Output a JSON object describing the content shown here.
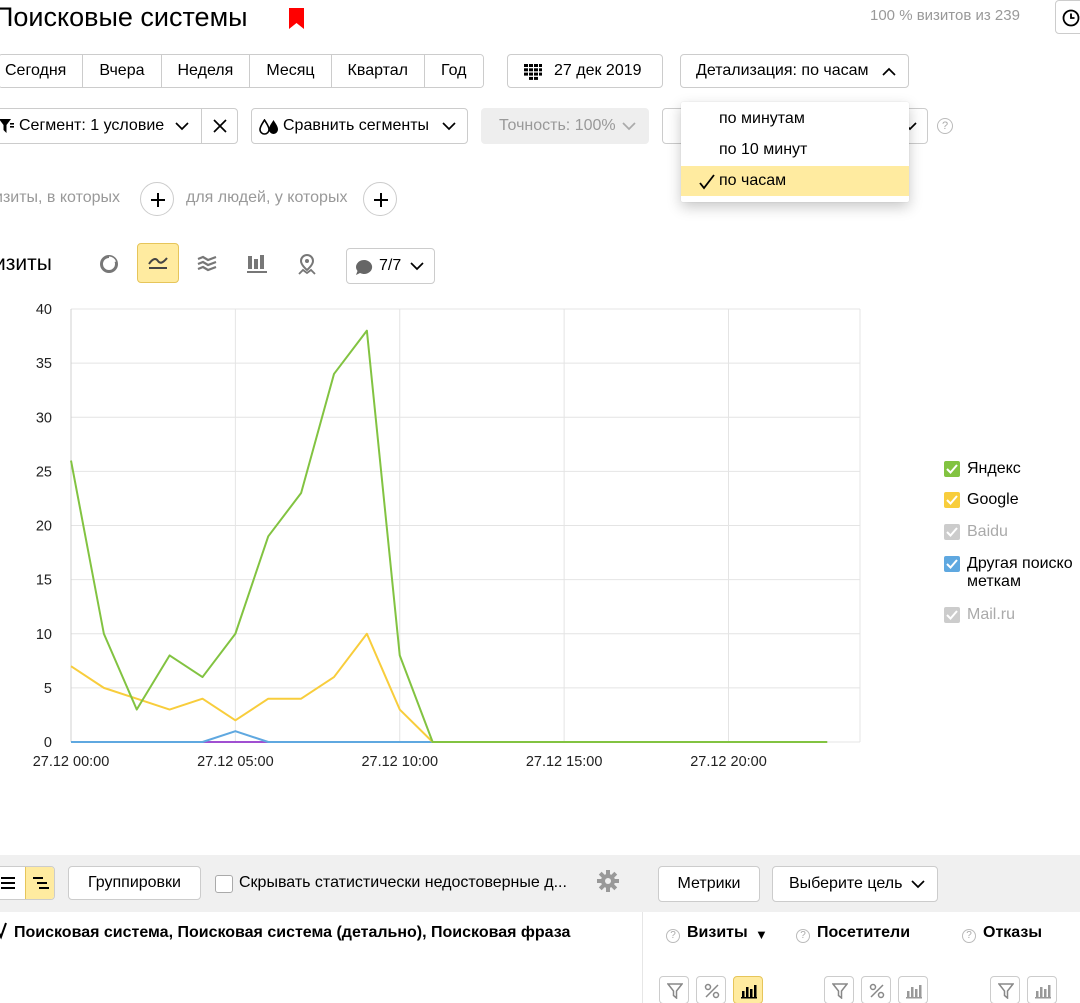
{
  "header": {
    "title": "Поисковые системы",
    "visits_info": "100 % визитов из 239"
  },
  "periods": [
    "Сегодня",
    "Вчера",
    "Неделя",
    "Месяц",
    "Квартал",
    "Год"
  ],
  "date_label": "27 дек 2019",
  "detail_label": "Детализация: по часам",
  "detail_options": [
    "по минутам",
    "по 10 минут",
    "по часам"
  ],
  "detail_selected": "по часам",
  "segment_label": "Сегмент: 1 условие",
  "compare_label": "Сравнить сегменты",
  "accuracy_label": "Точность: 100%",
  "conditions": {
    "visits_prefix": "изиты, в которых",
    "people_prefix": "для людей, у которых"
  },
  "chart_toolbar": {
    "label": "изиты",
    "series_count": "7/7"
  },
  "chart_data": {
    "type": "line",
    "x": [
      "27.12 00:00",
      "27.12 01:00",
      "27.12 02:00",
      "27.12 03:00",
      "27.12 04:00",
      "27.12 05:00",
      "27.12 06:00",
      "27.12 07:00",
      "27.12 08:00",
      "27.12 09:00",
      "27.12 10:00",
      "27.12 11:00",
      "27.12 12:00",
      "27.12 13:00",
      "27.12 14:00",
      "27.12 15:00",
      "27.12 16:00",
      "27.12 17:00",
      "27.12 18:00",
      "27.12 19:00",
      "27.12 20:00",
      "27.12 21:00",
      "27.12 22:00",
      "27.12 23:00"
    ],
    "x_tick_labels": [
      "27.12 00:00",
      "27.12 05:00",
      "27.12 10:00",
      "27.12 15:00",
      "27.12 20:00"
    ],
    "ylim": [
      0,
      40
    ],
    "y_ticks": [
      0,
      5,
      10,
      15,
      20,
      25,
      30,
      35,
      40
    ],
    "grid": true,
    "legend_position": "right",
    "series": [
      {
        "name": "Яндекс",
        "color": "#82c341",
        "checked": true,
        "values": [
          26,
          10,
          3,
          8,
          6,
          10,
          19,
          23,
          34,
          38,
          8,
          0,
          0,
          0,
          0,
          0,
          0,
          0,
          0,
          0,
          0,
          0,
          0,
          0
        ]
      },
      {
        "name": "Google",
        "color": "#f8cd3c",
        "checked": true,
        "values": [
          7,
          5,
          4,
          3,
          4,
          2,
          4,
          4,
          6,
          10,
          3,
          0,
          0,
          0,
          0,
          0,
          0,
          0,
          0,
          0,
          0,
          0,
          0,
          0
        ]
      },
      {
        "name": "Baidu",
        "color": "#cccccc",
        "checked": false,
        "values": [
          0,
          0,
          0,
          0,
          0,
          0,
          0,
          0,
          0,
          0,
          0,
          0,
          0,
          0,
          0,
          0,
          0,
          0,
          0,
          0,
          0,
          0,
          0,
          0
        ]
      },
      {
        "name": "Другая поисковая система по меткам",
        "color": "#5fa8e0",
        "checked": true,
        "values": [
          0,
          0,
          0,
          0,
          0,
          1,
          0,
          0,
          0,
          0,
          0,
          0,
          0,
          0,
          0,
          0,
          0,
          0,
          0,
          0,
          0,
          0,
          0,
          0
        ]
      },
      {
        "name": "Mail.ru",
        "color": "#cccccc",
        "checked": false,
        "values": [
          0,
          0,
          0,
          0,
          0,
          0,
          0,
          0,
          0,
          0,
          0,
          0,
          0,
          0,
          0,
          0,
          0,
          0,
          0,
          0,
          0,
          0,
          0,
          0
        ]
      },
      {
        "name": "",
        "color": "#a04fd1",
        "checked": true,
        "values": [
          0,
          0,
          0,
          0,
          0,
          0,
          0,
          0,
          0,
          0,
          0,
          0,
          0,
          0,
          0,
          0,
          0,
          0,
          0,
          0,
          0,
          0,
          0,
          0
        ]
      }
    ]
  },
  "legend": [
    {
      "line1": "Яндекс",
      "line2": "",
      "color": "#82c341",
      "checked": true
    },
    {
      "line1": "Google",
      "line2": "",
      "color": "#f8cd3c",
      "checked": true
    },
    {
      "line1": "Baidu",
      "line2": "",
      "color": "#cccccc",
      "checked": false
    },
    {
      "line1": "Другая поиско",
      "line2": "меткам",
      "color": "#5fa8e0",
      "checked": true
    },
    {
      "line1": "Mail.ru",
      "line2": "",
      "color": "#cccccc",
      "checked": false
    }
  ],
  "table": {
    "groupings_label": "Группировки",
    "hide_label": "Скрывать статистически недостоверные д...",
    "metrics_label": "Метрики",
    "goal_label": "Выберите цель",
    "dimensions_header": "Поисковая система, Поисковая система (детально), Поисковая фраза",
    "columns": [
      "Визиты",
      "Посетители",
      "Отказы"
    ],
    "sort_marker": "▼"
  }
}
